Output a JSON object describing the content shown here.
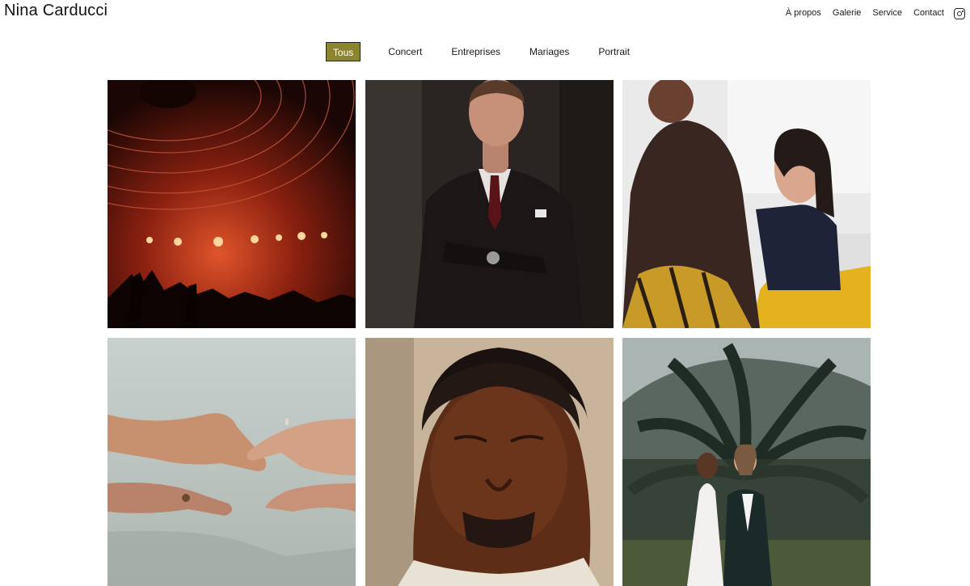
{
  "header": {
    "site_title": "Nina Carducci",
    "nav": [
      {
        "label": "À propos"
      },
      {
        "label": "Galerie"
      },
      {
        "label": "Service"
      },
      {
        "label": "Contact"
      }
    ],
    "social_icon": "instagram-icon"
  },
  "gallery": {
    "filters": [
      {
        "label": "Tous",
        "active": true
      },
      {
        "label": "Concert"
      },
      {
        "label": "Entreprises"
      },
      {
        "label": "Mariages"
      },
      {
        "label": "Portrait"
      }
    ],
    "active_color": "#8b8530",
    "photos": [
      {
        "subject": "concert-stage"
      },
      {
        "subject": "businessman-portrait"
      },
      {
        "subject": "office-meeting"
      },
      {
        "subject": "hands-reaching"
      },
      {
        "subject": "man-portrait-closeup"
      },
      {
        "subject": "wedding-couple-palm"
      }
    ]
  }
}
